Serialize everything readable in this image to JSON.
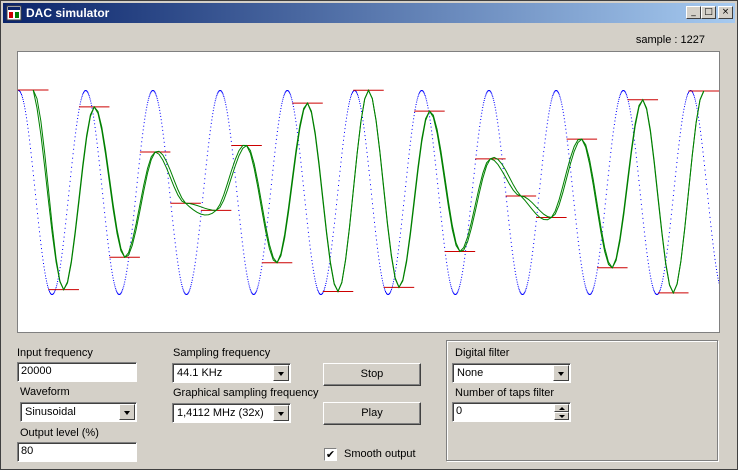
{
  "window": {
    "title": "DAC simulator",
    "minimize": "_",
    "maximize": "□",
    "close": "×"
  },
  "status": {
    "sample": "sample : 1227"
  },
  "controls": {
    "input_frequency": {
      "label": "Input frequency",
      "value": "20000"
    },
    "waveform": {
      "label": "Waveform",
      "value": "Sinusoidal"
    },
    "output_level": {
      "label": "Output level (%)",
      "value": "80"
    },
    "sampling_frequency": {
      "label": "Sampling frequency",
      "value": "44.1 KHz"
    },
    "graphical_sampling": {
      "label": "Graphical sampling frequency",
      "value": "1,4112 MHz (32x)"
    },
    "stop_label": "Stop",
    "play_label": "Play",
    "smooth_output": {
      "label": "Smooth output",
      "checked": true,
      "mark": "✔"
    }
  },
  "digital_filter": {
    "group_label": "Digital filter",
    "value": "None",
    "taps_label": "Number of taps filter",
    "taps_value": "0"
  },
  "colors": {
    "input_signal": "#0000ff",
    "sample_hold": "#cc0000",
    "output": "#008000"
  },
  "chart_data": {
    "type": "line",
    "input_frequency_hz": 20000,
    "sampling_rate_hz": 44100,
    "amplitude": 0.8,
    "samples_shown": 23
  }
}
